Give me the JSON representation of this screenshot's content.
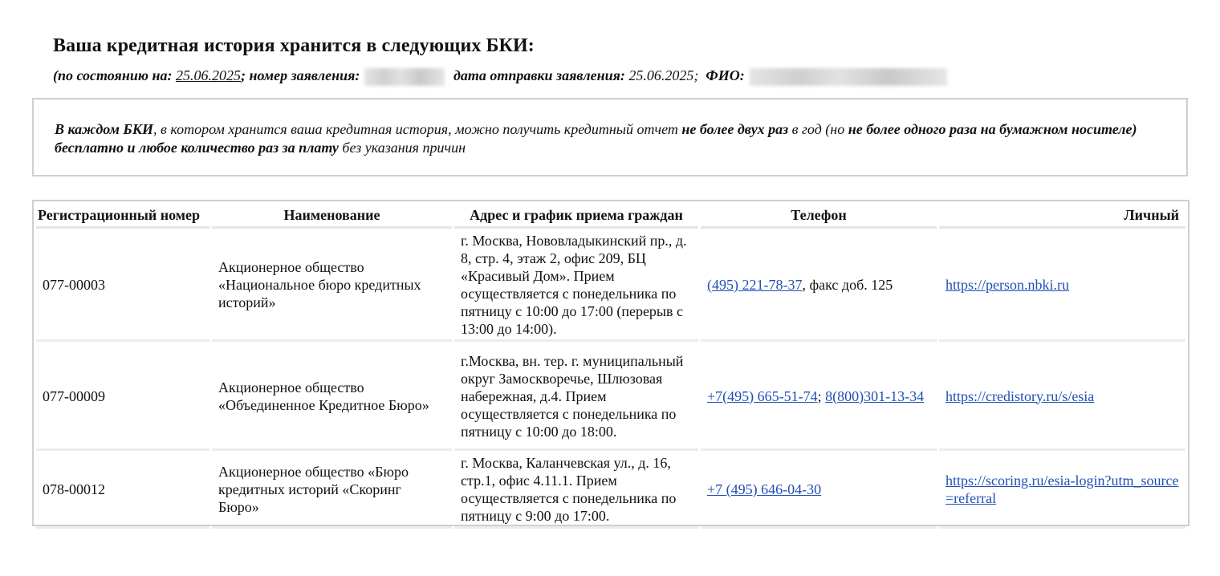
{
  "header": {
    "title": "Ваша кредитная история хранится в следующих БКИ:",
    "as_of_label": "(по состоянию на:",
    "as_of_date": "25.06.2025",
    "application_label": "; номер заявления:",
    "sent_label": "дата отправки заявления:",
    "sent_date": "25.06.2025;",
    "fio_label": "ФИО:"
  },
  "notice": {
    "p1": "В каждом БКИ",
    "p2": ", в котором хранится ваша кредитная история, можно получить кредитный отчет ",
    "p3": "не более двух раз",
    "p4": " в год (но ",
    "p5": "не более одного раза на бумажном носителе) бесплатно и любое количество раз за плату",
    "p6": " без указания причин"
  },
  "table": {
    "headers": {
      "reg": "Регистрационный номер",
      "name": "Наименование",
      "address": "Адрес и график приема граждан",
      "phone": "Телефон",
      "personal": "Личный"
    },
    "rows": [
      {
        "reg": "077-00003",
        "name": "Акционерное общество «Национальное бюро кредитных историй»",
        "address": "г. Москва, Нововладыкинский пр., д. 8, стр. 4, этаж 2, офис 209, БЦ «Красивый Дом». Прием осуществляется с понедельника по пятницу с 10:00 до 17:00 (перерыв с 13:00 до 14:00).",
        "phone1": "(495) 221-78-37",
        "phone_sep": ", факс доб. 125",
        "phone2": "",
        "link": "https://person.nbki.ru"
      },
      {
        "reg": "077-00009",
        "name": "Акционерное общество «Объединенное Кредитное Бюро»",
        "address": "г.Москва, вн. тер. г. муниципальный округ Замоскворечье, Шлюзовая набережная, д.4. Прием осуществляется с понедельника по пятницу с 10:00 до 18:00.",
        "phone1": "+7(495) 665-51-74",
        "phone_sep": "; ",
        "phone2": "8(800)301-13-34",
        "link": "https://credistory.ru/s/esia"
      },
      {
        "reg": "078-00012",
        "name": "Акционерное общество «Бюро кредитных историй «Скоринг Бюро»",
        "address": "г. Москва, Каланчевская ул., д. 16, стр.1, офис 4.11.1. Прием осуществляется с понедельника по пятницу с 9:00 до 17:00.",
        "phone1": "+7 (495) 646-04-30",
        "phone_sep": "",
        "phone2": "",
        "link": "https://scoring.ru/esia-login?utm_source=referral"
      }
    ]
  },
  "colors": {
    "link": "#1f4fb5",
    "border": "#cfcfcf"
  }
}
